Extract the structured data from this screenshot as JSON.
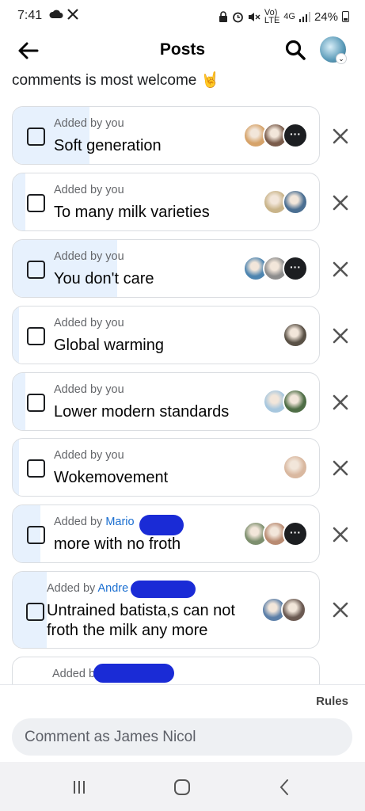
{
  "status_bar": {
    "time": "7:41",
    "battery": "24%",
    "network": "4G",
    "network_type": "LTE",
    "volte": "Vo)"
  },
  "header": {
    "title": "Posts",
    "icons": [
      "back-arrow-icon",
      "search-icon",
      "profile-avatar"
    ]
  },
  "intro_text": "comments is most welcome 🤘",
  "options": [
    {
      "added_prefix": "Added by you",
      "added_name": "",
      "label": "Soft generation",
      "vote_share": 0.25,
      "voters": [
        "#d6a36a",
        "#7a5c4b"
      ],
      "more": true
    },
    {
      "added_prefix": "Added by you",
      "added_name": "",
      "label": "To many milk varieties",
      "vote_share": 0.04,
      "voters": [
        "#c9b48a",
        "#4b6f92"
      ],
      "more": false
    },
    {
      "added_prefix": "Added by you",
      "added_name": "",
      "label": "You don't care",
      "vote_share": 0.34,
      "voters": [
        "#4e85b0",
        "#8d8d8d"
      ],
      "more": true
    },
    {
      "added_prefix": "Added by you",
      "added_name": "",
      "label": "Global warming",
      "vote_share": 0.02,
      "voters": [
        "#5a5146"
      ],
      "more": false
    },
    {
      "added_prefix": "Added by you",
      "added_name": "",
      "label": "Lower modern standards",
      "vote_share": 0.04,
      "voters": [
        "#a7c7de",
        "#4f6e46"
      ],
      "more": false
    },
    {
      "added_prefix": "Added by you",
      "added_name": "",
      "label": "Wokemovement",
      "vote_share": 0.02,
      "voters": [
        "#d9b8a0"
      ],
      "more": false
    },
    {
      "added_prefix": "Added by ",
      "added_name": "Mario",
      "label": "more with no froth",
      "vote_share": 0.09,
      "voters": [
        "#7d8f6e",
        "#b98b72"
      ],
      "more": true
    },
    {
      "added_prefix": "Added by ",
      "added_name": "Andre",
      "label": "Untrained batista,s can not froth the milk any more",
      "vote_share": 0.11,
      "voters": [
        "#5c7fa8",
        "#6b5a52"
      ],
      "more": false
    },
    {
      "added_prefix": "Added b",
      "added_name": "",
      "label": "",
      "vote_share": 0,
      "voters": [],
      "more": false
    }
  ],
  "footer": {
    "rules_label": "Rules",
    "comment_placeholder": "Comment as James Nicol"
  },
  "colors": {
    "accent_blue": "#1b6fd1",
    "vote_fill": "#e7f1fd",
    "redaction": "#1a2bd6"
  }
}
